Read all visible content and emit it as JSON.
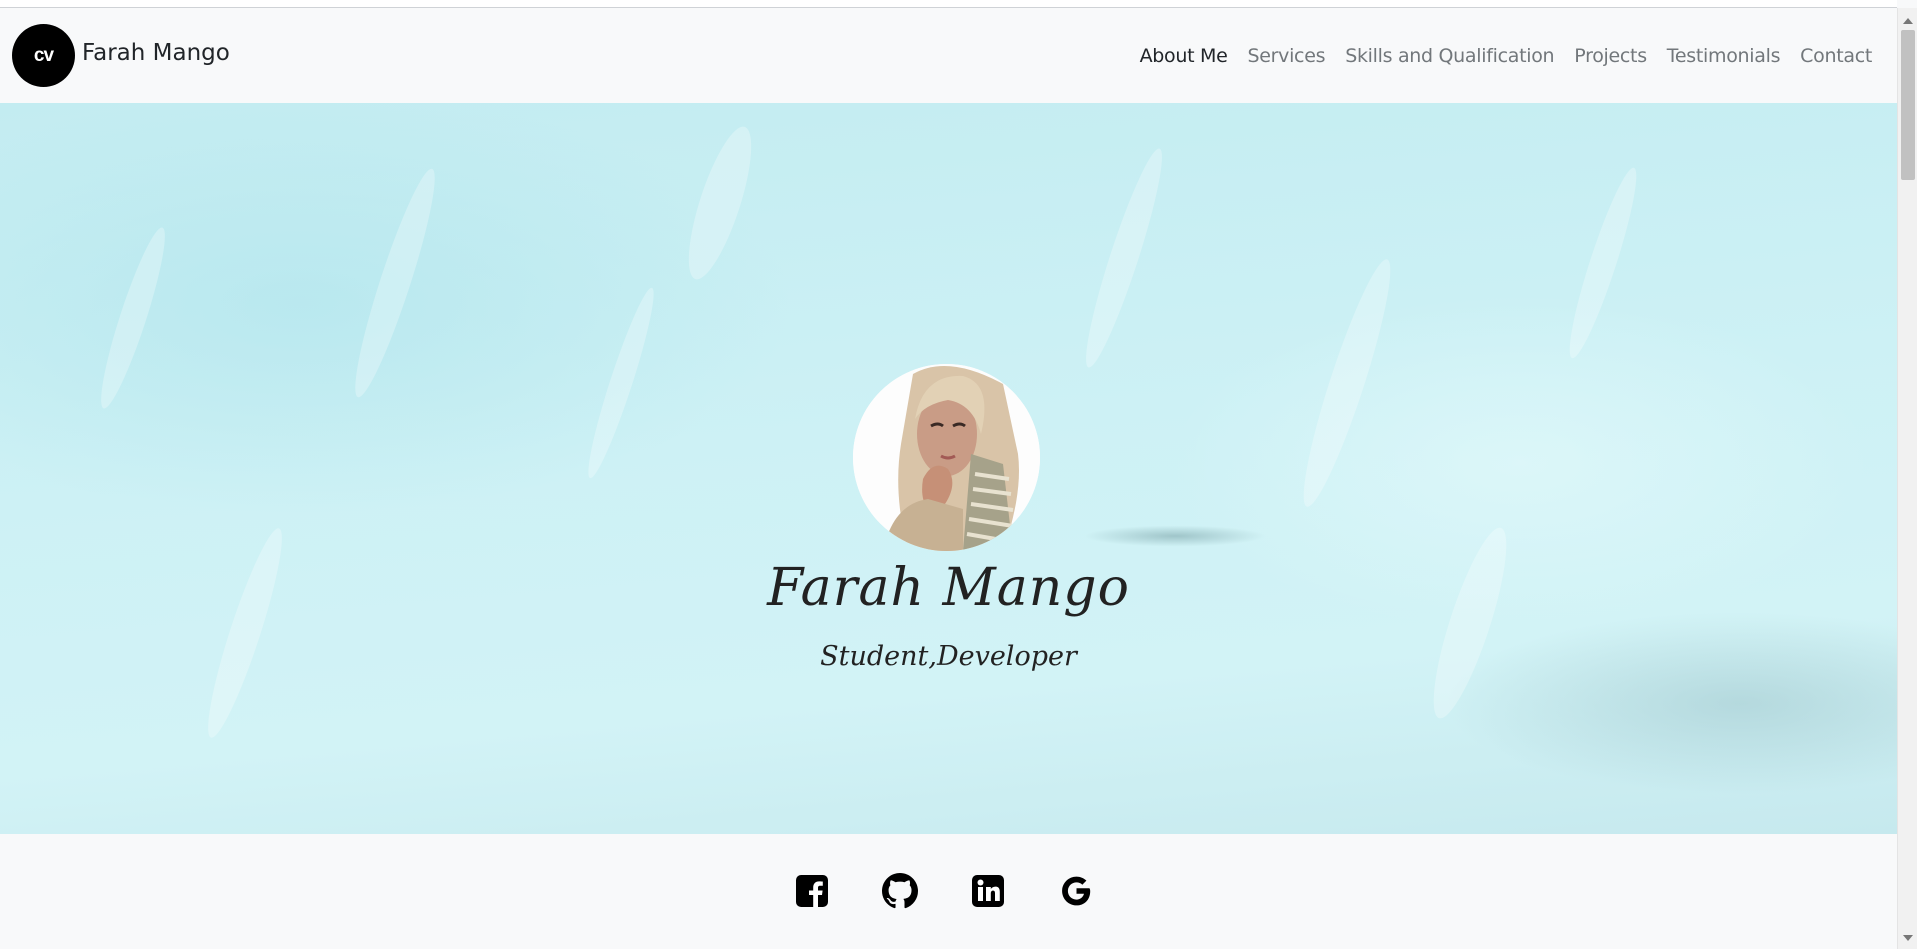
{
  "brand": {
    "logo_text": "cv",
    "name": "Farah Mango"
  },
  "nav": {
    "items": [
      {
        "label": "About Me",
        "active": true
      },
      {
        "label": "Services",
        "active": false
      },
      {
        "label": "Skills and Qualification",
        "active": false
      },
      {
        "label": "Projects",
        "active": false
      },
      {
        "label": "Testimonials",
        "active": false
      },
      {
        "label": "Contact",
        "active": false
      }
    ]
  },
  "hero": {
    "photo": "profile-photo",
    "name": "Farah Mango",
    "tagline": "Student,Developer"
  },
  "social": {
    "icons": [
      "facebook-icon",
      "github-icon",
      "linkedin-icon",
      "google-icon"
    ]
  },
  "colors": {
    "hero_bg": "#c8eef3",
    "nav_bg": "#f8f9fa",
    "logo_bg": "#000000",
    "text_dark": "#212529",
    "nav_muted": "#72777b"
  }
}
